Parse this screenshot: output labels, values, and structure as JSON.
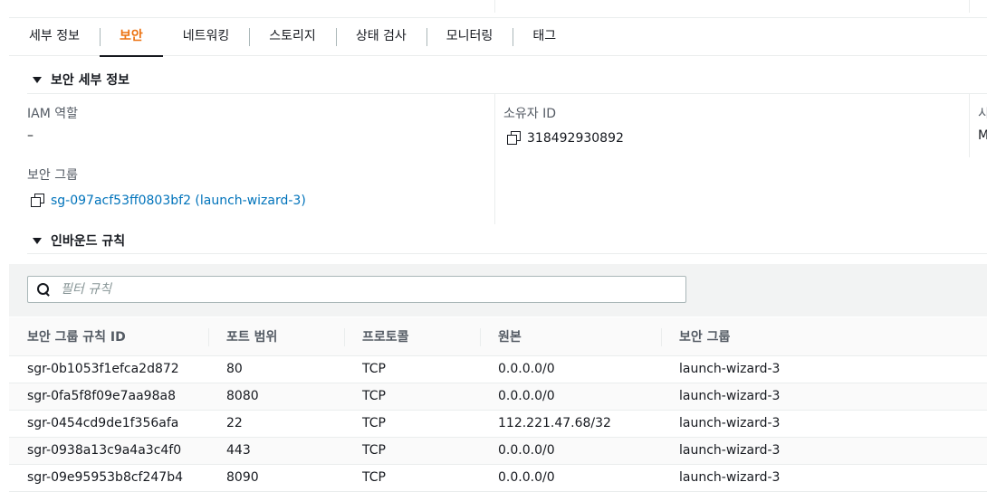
{
  "tabs": [
    {
      "label": "세부 정보"
    },
    {
      "label": "보안",
      "active": true
    },
    {
      "label": "네트워킹"
    },
    {
      "label": "스토리지"
    },
    {
      "label": "상태 검사"
    },
    {
      "label": "모니터링"
    },
    {
      "label": "태그"
    }
  ],
  "security_details": {
    "title": "보안 세부 정보",
    "iam_role_label": "IAM 역할",
    "iam_role_value": "–",
    "owner_id_label": "소유자 ID",
    "owner_id_value": "318492930892",
    "third_col_label": "시",
    "third_col_value": "M",
    "security_group_label": "보안 그룹",
    "security_group_value": "sg-097acf53ff0803bf2 (launch-wizard-3)"
  },
  "inbound_rules": {
    "title": "인바운드 규칙",
    "filter_placeholder": "필터 규칙",
    "columns": [
      "보안 그룹 규칙 ID",
      "포트 범위",
      "프로토콜",
      "원본",
      "보안 그룹"
    ],
    "rows": [
      [
        "sgr-0b1053f1efca2d872",
        "80",
        "TCP",
        "0.0.0.0/0",
        "launch-wizard-3"
      ],
      [
        "sgr-0fa5f8f09e7aa98a8",
        "8080",
        "TCP",
        "0.0.0.0/0",
        "launch-wizard-3"
      ],
      [
        "sgr-0454cd9de1f356afa",
        "22",
        "TCP",
        "112.221.47.68/32",
        "launch-wizard-3"
      ],
      [
        "sgr-0938a13c9a4a3c4f0",
        "443",
        "TCP",
        "0.0.0.0/0",
        "launch-wizard-3"
      ],
      [
        "sgr-09e95953b8cf247b4",
        "8090",
        "TCP",
        "0.0.0.0/0",
        "launch-wizard-3"
      ]
    ]
  }
}
